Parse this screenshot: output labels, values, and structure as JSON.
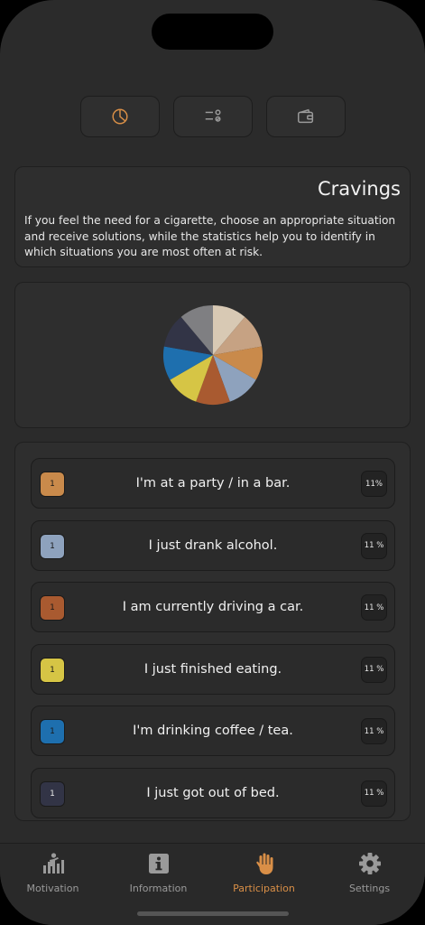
{
  "top_buttons": [
    {
      "icon": "pie-chart-icon",
      "active": true
    },
    {
      "icon": "checklist-icon",
      "active": false
    },
    {
      "icon": "wallet-icon",
      "active": false
    }
  ],
  "info": {
    "title": "Cravings",
    "description": "If you feel the need for a cigarette, choose an appropriate situation and receive solutions, while the statistics help you to identify in which situations you are most often at risk."
  },
  "pie": {
    "slices": [
      {
        "value": 1,
        "color": "#d8c9b4"
      },
      {
        "value": 1,
        "color": "#c6a283"
      },
      {
        "value": 1,
        "color": "#c98a4b"
      },
      {
        "value": 1,
        "color": "#8ea2bd"
      },
      {
        "value": 1,
        "color": "#a95a30"
      },
      {
        "value": 1,
        "color": "#d6c545"
      },
      {
        "value": 1,
        "color": "#1e6fae"
      },
      {
        "value": 1,
        "color": "#323446"
      },
      {
        "value": 1,
        "color": "#7f7f82"
      }
    ]
  },
  "situations": [
    {
      "count": "1",
      "label": "I'm at a party / in a bar.",
      "percent": "11%",
      "color": "#c98a4b"
    },
    {
      "count": "1",
      "label": "I just drank alcohol.",
      "percent": "11 %",
      "color": "#8ea2bd"
    },
    {
      "count": "1",
      "label": "I am currently driving a car.",
      "percent": "11 %",
      "color": "#a95a30"
    },
    {
      "count": "1",
      "label": "I just finished eating.",
      "percent": "11 %",
      "color": "#d6c545"
    },
    {
      "count": "1",
      "label": "I'm drinking coffee / tea.",
      "percent": "11 %",
      "color": "#1e6fae"
    },
    {
      "count": "1",
      "label": "I just got out of bed.",
      "percent": "11 %",
      "color": "#323446"
    }
  ],
  "tabs": [
    {
      "label": "Motivation",
      "icon": "motivation-chart-icon",
      "active": false
    },
    {
      "label": "Information",
      "icon": "info-icon",
      "active": false
    },
    {
      "label": "Participation",
      "icon": "hand-icon",
      "active": true
    },
    {
      "label": "Settings",
      "icon": "gear-icon",
      "active": false
    }
  ],
  "colors": {
    "accent": "#d98f47",
    "inactive": "#9a9a9a"
  }
}
